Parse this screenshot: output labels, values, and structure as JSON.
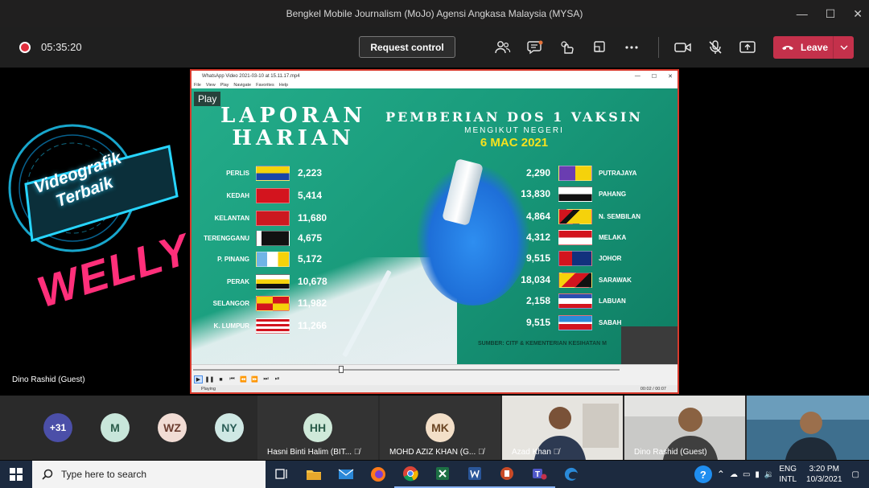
{
  "window": {
    "title": "Bengkel Mobile Journalism (MoJo) Agensi Angkasa Malaysia (MYSA)",
    "controls": [
      "—",
      "☐",
      "✕"
    ]
  },
  "toolbar": {
    "timer": "05:35:20",
    "request_control": "Request control",
    "leave_label": "Leave",
    "icons": [
      "participants-icon",
      "chat-icon",
      "reactions-icon",
      "rooms-icon",
      "more-icon",
      "camera-icon",
      "mic-off-icon",
      "share-icon"
    ]
  },
  "left_video": {
    "badge_text": "Videografik\nTerbaik",
    "name_art": "WELLY",
    "participant_name": "Dino Rashid (Guest)"
  },
  "player": {
    "title": "WhatsApp Video 2021-03-10 at 15.11.17.mp4",
    "menu": [
      "File",
      "View",
      "Play",
      "Navigate",
      "Favorites",
      "Help"
    ],
    "play_overlay": "Play",
    "status": "Playing",
    "time": "00:02 / 00:07"
  },
  "infographic": {
    "title_line1": "LAPORAN",
    "title_line2": "HARIAN",
    "headline": "PEMBERIAN DOS 1 VAKSIN",
    "subheadline": "MENGIKUT NEGERI",
    "date": "6 MAC 2021",
    "source": "SUMBER: CITF & KEMENTERIAN KESIHATAN M",
    "left_states": [
      {
        "name": "PERLIS",
        "value": "2,223"
      },
      {
        "name": "KEDAH",
        "value": "5,414"
      },
      {
        "name": "KELANTAN",
        "value": "11,680"
      },
      {
        "name": "TERENGGANU",
        "value": "4,675"
      },
      {
        "name": "P. PINANG",
        "value": "5,172"
      },
      {
        "name": "PERAK",
        "value": "10,678"
      },
      {
        "name": "SELANGOR",
        "value": "11,982"
      },
      {
        "name": "K. LUMPUR",
        "value": "11,266"
      }
    ],
    "right_states": [
      {
        "name": "PUTRAJAYA",
        "value": "2,290"
      },
      {
        "name": "PAHANG",
        "value": "13,830"
      },
      {
        "name": "N. SEMBILAN",
        "value": "4,864"
      },
      {
        "name": "MELAKA",
        "value": "4,312"
      },
      {
        "name": "JOHOR",
        "value": "9,515"
      },
      {
        "name": "SARAWAK",
        "value": "18,034"
      },
      {
        "name": "LABUAN",
        "value": "2,158"
      },
      {
        "name": "SABAH",
        "value": "9,515"
      }
    ]
  },
  "participants": {
    "overflow": "+31",
    "avatars": [
      {
        "initials": "M",
        "bg": "#c8e6da",
        "fg": "#2b5d4a"
      },
      {
        "initials": "WZ",
        "bg": "#f1dcd4",
        "fg": "#6a3b2e"
      },
      {
        "initials": "NY",
        "bg": "#cfe8e4",
        "fg": "#2b5e57"
      }
    ],
    "tiles": [
      {
        "initials": "HH",
        "name": "Hasni Binti Halim (BIT...",
        "bg": "#cfe9d9",
        "fg": "#2b5d4a"
      },
      {
        "initials": "MK",
        "name": "MOHD AZIZ KHAN (G...",
        "bg": "#f3dfc8",
        "fg": "#6a4422"
      }
    ],
    "video_tiles": [
      {
        "name": "Azad Khan"
      },
      {
        "name": "Dino Rashid (Guest)"
      },
      {
        "name": ""
      }
    ]
  },
  "taskbar": {
    "search_placeholder": "Type here to search",
    "lang_top": "ENG",
    "lang_bottom": "INTL",
    "time": "3:20 PM",
    "date": "10/3/2021"
  },
  "colors": {
    "leave": "#c4314b",
    "taskbar": "#1c2a3f",
    "infographic_bg": "#18997a",
    "date_yellow": "#f6e21e"
  }
}
